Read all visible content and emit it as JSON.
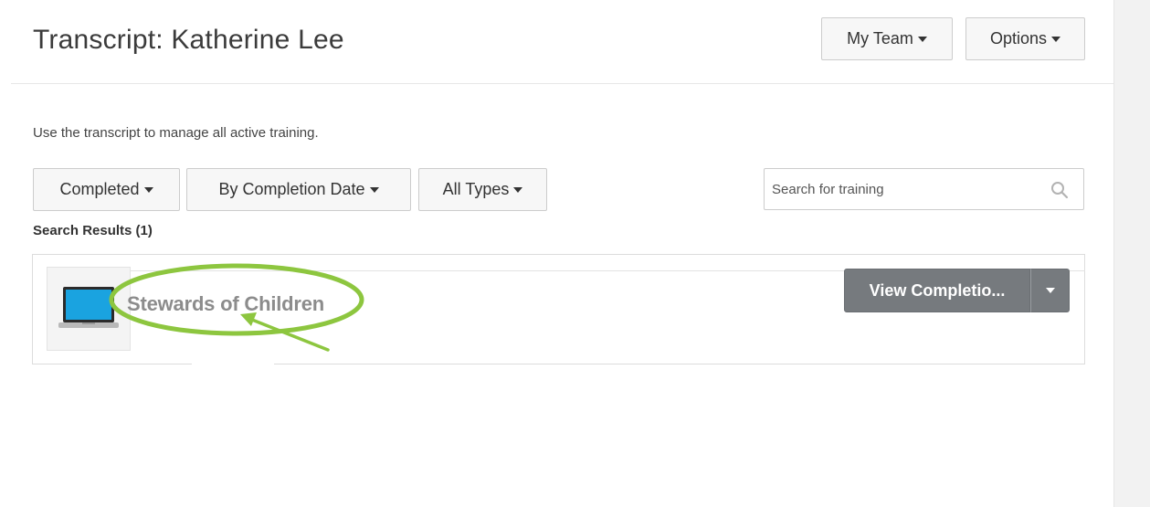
{
  "header": {
    "title": "Transcript: Katherine Lee",
    "my_team_label": "My Team",
    "options_label": "Options"
  },
  "intro": {
    "text": "Use the transcript to manage all active training."
  },
  "filters": {
    "status_label": "Completed",
    "sort_label": "By Completion Date",
    "type_label": "All Types"
  },
  "search": {
    "placeholder": "Search for training"
  },
  "results": {
    "label": "Search Results (1)",
    "items": [
      {
        "title": "Stewards of Children",
        "action_label": "View Completio...",
        "icon": "laptop-icon"
      }
    ]
  },
  "annotation": {
    "highlight_color": "#8dc63f"
  }
}
